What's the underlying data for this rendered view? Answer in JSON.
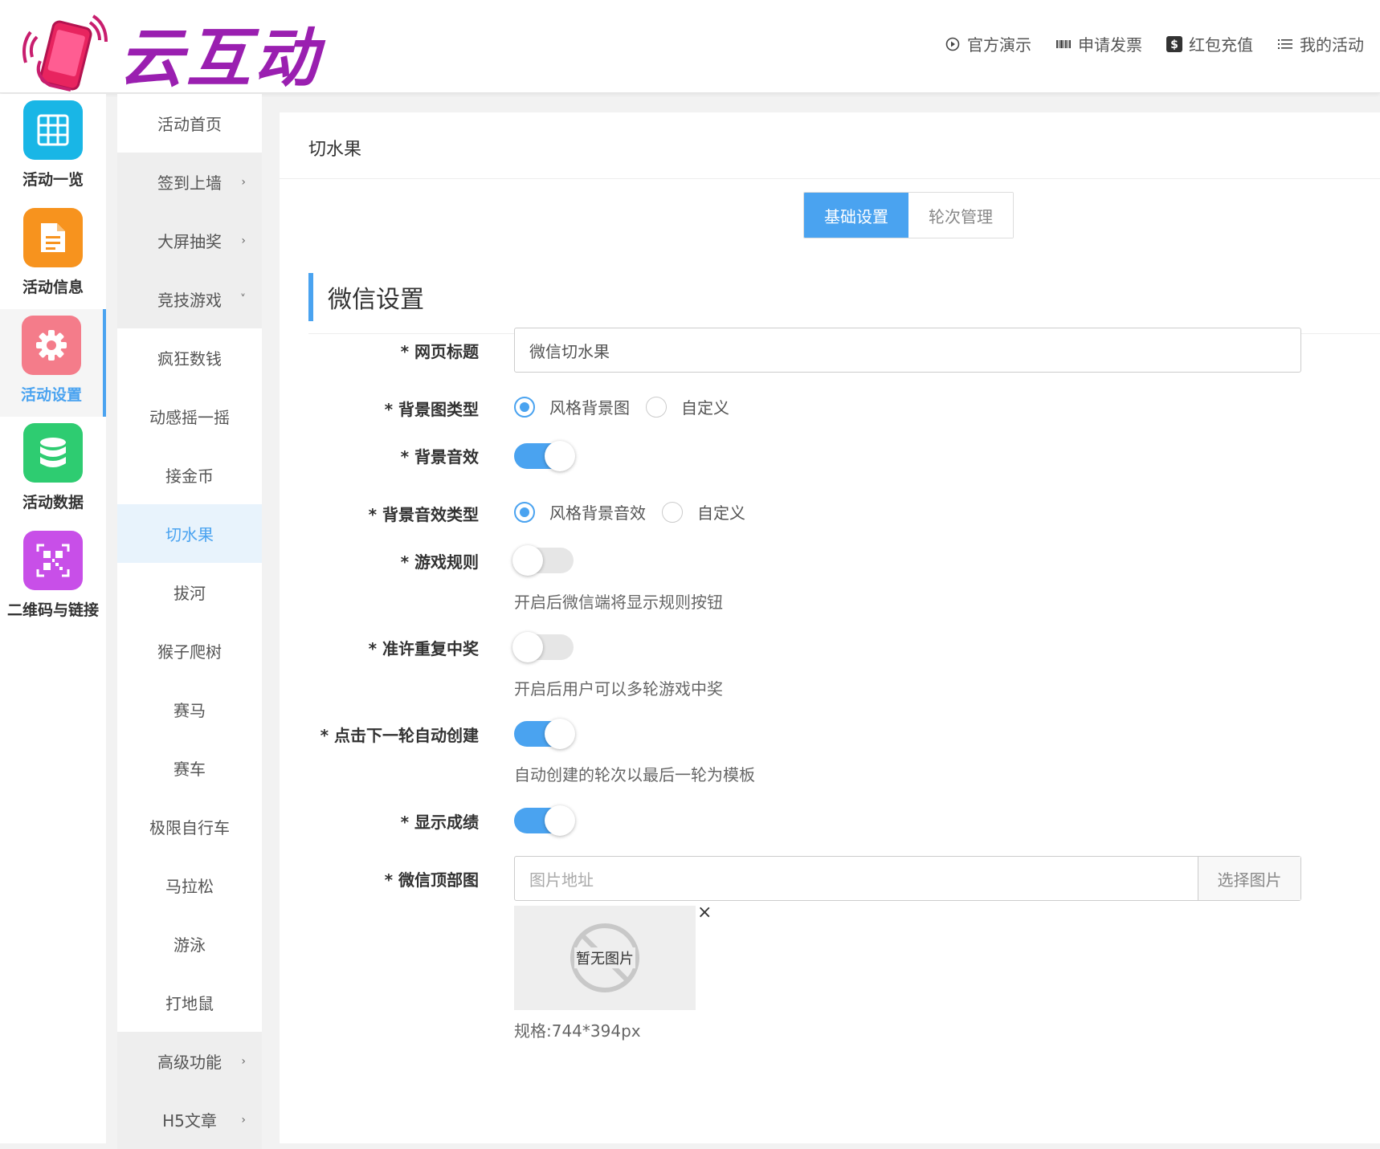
{
  "header": {
    "logo_text": "云互动",
    "nav": [
      {
        "label": "官方演示",
        "icon": "play-circle-icon"
      },
      {
        "label": "申请发票",
        "icon": "barcode-icon"
      },
      {
        "label": "红包充值",
        "icon": "dollar-icon"
      },
      {
        "label": "我的活动",
        "icon": "list-icon"
      }
    ]
  },
  "icon_sidebar": {
    "items": [
      {
        "label": "活动一览",
        "icon": "grid-icon",
        "color": "#19b6e6"
      },
      {
        "label": "活动信息",
        "icon": "document-icon",
        "color": "#f7931e"
      },
      {
        "label": "活动设置",
        "icon": "gear-icon",
        "color": "#f47c8a"
      },
      {
        "label": "活动数据",
        "icon": "database-icon",
        "color": "#2ecc71"
      },
      {
        "label": "二维码与链接",
        "icon": "qrcode-icon",
        "color": "#c84fe8"
      }
    ],
    "active_index": 2
  },
  "sub_sidebar": {
    "items": [
      {
        "label": "活动首页",
        "chevron": ""
      },
      {
        "label": "签到上墙",
        "chevron": "›"
      },
      {
        "label": "大屏抽奖",
        "chevron": "›"
      },
      {
        "label": "竞技游戏",
        "chevron": "˅"
      },
      {
        "label": "疯狂数钱",
        "chevron": ""
      },
      {
        "label": "动感摇一摇",
        "chevron": ""
      },
      {
        "label": "接金币",
        "chevron": ""
      },
      {
        "label": "切水果",
        "chevron": ""
      },
      {
        "label": "拔河",
        "chevron": ""
      },
      {
        "label": "猴子爬树",
        "chevron": ""
      },
      {
        "label": "赛马",
        "chevron": ""
      },
      {
        "label": "赛车",
        "chevron": ""
      },
      {
        "label": "极限自行车",
        "chevron": ""
      },
      {
        "label": "马拉松",
        "chevron": ""
      },
      {
        "label": "游泳",
        "chevron": ""
      },
      {
        "label": "打地鼠",
        "chevron": ""
      },
      {
        "label": "高级功能",
        "chevron": "›"
      },
      {
        "label": "H5文章",
        "chevron": "›"
      }
    ],
    "active_index": 7
  },
  "main": {
    "breadcrumb": "切水果",
    "tabs": [
      {
        "label": "基础设置"
      },
      {
        "label": "轮次管理"
      }
    ],
    "section_title": "微信设置",
    "form": {
      "page_title": {
        "label": "* 网页标题",
        "value": "微信切水果"
      },
      "bg_type": {
        "label": "* 背景图类型",
        "options": [
          "风格背景图",
          "自定义"
        ],
        "selected": 0
      },
      "bg_sound": {
        "label": "* 背景音效",
        "on": true
      },
      "bg_sound_type": {
        "label": "* 背景音效类型",
        "options": [
          "风格背景音效",
          "自定义"
        ],
        "selected": 0
      },
      "game_rules": {
        "label": "* 游戏规则",
        "on": false,
        "hint": "开启后微信端将显示规则按钮"
      },
      "repeat_win": {
        "label": "* 准许重复中奖",
        "on": false,
        "hint": "开启后用户可以多轮游戏中奖"
      },
      "auto_create": {
        "label": "* 点击下一轮自动创建",
        "on": true,
        "hint": "自动创建的轮次以最后一轮为模板"
      },
      "show_score": {
        "label": "* 显示成绩",
        "on": true
      },
      "top_image": {
        "label": "* 微信顶部图",
        "placeholder": "图片地址",
        "button": "选择图片",
        "preview_text": "暂无图片",
        "close": "×",
        "spec": "规格:744*394px"
      }
    }
  }
}
